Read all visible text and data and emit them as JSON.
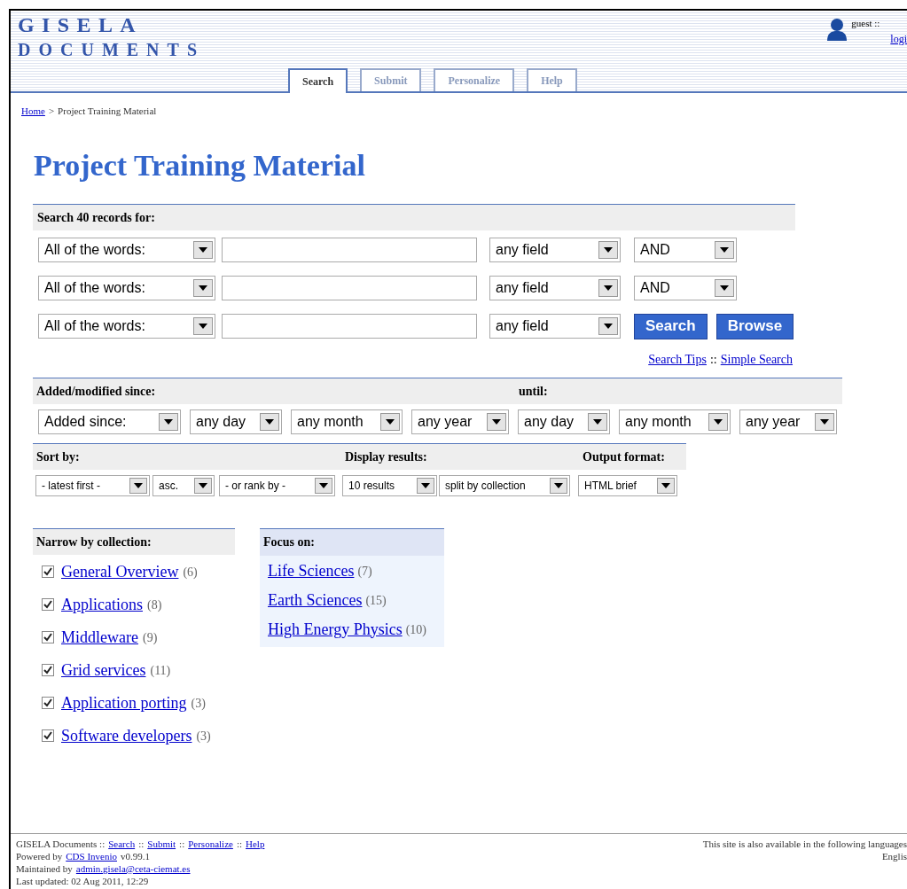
{
  "header": {
    "logo_line_1": "GISELA",
    "logo_line_2": "DOCUMENTS",
    "user": "guest ::",
    "login": "logi"
  },
  "tabs": [
    {
      "label": "Search",
      "selected": true
    },
    {
      "label": "Submit",
      "selected": false
    },
    {
      "label": "Personalize",
      "selected": false
    },
    {
      "label": "Help",
      "selected": false
    }
  ],
  "breadcrumb": {
    "home": "Home",
    "separator": ">",
    "current": "Project Training Material"
  },
  "title": "Project Training Material",
  "search": {
    "heading": "Search 40 records for:",
    "rows": [
      {
        "match": "All of the words:",
        "field": "any field",
        "operator": "AND"
      },
      {
        "match": "All of the words:",
        "field": "any field",
        "operator": "AND"
      },
      {
        "match": "All of the words:",
        "field": "any field"
      }
    ],
    "buttons": [
      "Search",
      "Browse"
    ],
    "links": [
      {
        "label": "Search Tips"
      },
      {
        "label": "::",
        "kind": "separator"
      },
      {
        "label": "Simple Search"
      }
    ]
  },
  "date_range": {
    "since_heading": "Added/modified since:",
    "until_heading": "until:",
    "since": [
      "Added since:",
      "any day",
      "any month",
      "any year"
    ],
    "until": [
      "any day",
      "any month",
      "any year"
    ]
  },
  "options": {
    "sort_heading": "Sort by:",
    "display_heading": "Display results:",
    "format_heading": "Output format:",
    "sort": [
      "- latest first -",
      "asc.",
      "- or rank by -"
    ],
    "display": [
      "10 results",
      "split by collection"
    ],
    "format": [
      "HTML brief"
    ]
  },
  "collections": {
    "heading": "Narrow by collection:",
    "items": [
      {
        "name": "General Overview",
        "count": "(6)",
        "checked": true
      },
      {
        "name": "Applications",
        "count": "(8)",
        "checked": true
      },
      {
        "name": "Middleware",
        "count": "(9)",
        "checked": true
      },
      {
        "name": "Grid services",
        "count": "(11)",
        "checked": true
      },
      {
        "name": "Application porting",
        "count": "(3)",
        "checked": true
      },
      {
        "name": "Software developers",
        "count": "(3)",
        "checked": true
      }
    ]
  },
  "focus": {
    "heading": "Focus on:",
    "items": [
      {
        "name": "Life Sciences",
        "count": "(7)"
      },
      {
        "name": "Earth Sciences",
        "count": "(15)"
      },
      {
        "name": "High Energy Physics",
        "count": "(10)"
      }
    ]
  },
  "footer": {
    "nav": [
      {
        "label": "GISELA Documents ::",
        "kind": "text"
      },
      {
        "label": "Search",
        "kind": "link"
      },
      {
        "label": "::",
        "kind": "text"
      },
      {
        "label": "Submit",
        "kind": "link"
      },
      {
        "label": "::",
        "kind": "text"
      },
      {
        "label": "Personalize",
        "kind": "link"
      },
      {
        "label": "::",
        "kind": "text"
      },
      {
        "label": "Help",
        "kind": "link"
      }
    ],
    "powered": [
      {
        "label": "Powered by",
        "kind": "text"
      },
      {
        "label": "CDS Invenio",
        "kind": "link"
      },
      {
        "label": "v0.99.1",
        "kind": "text"
      }
    ],
    "maintained": [
      {
        "label": "Maintained by",
        "kind": "text"
      },
      {
        "label": "admin.gisela@ceta-ciemat.es",
        "kind": "link"
      }
    ],
    "updated": "Last updated: 02 Aug 2011, 12:29",
    "languages_note": "This site is also available in the following languages",
    "language": "Englis"
  }
}
